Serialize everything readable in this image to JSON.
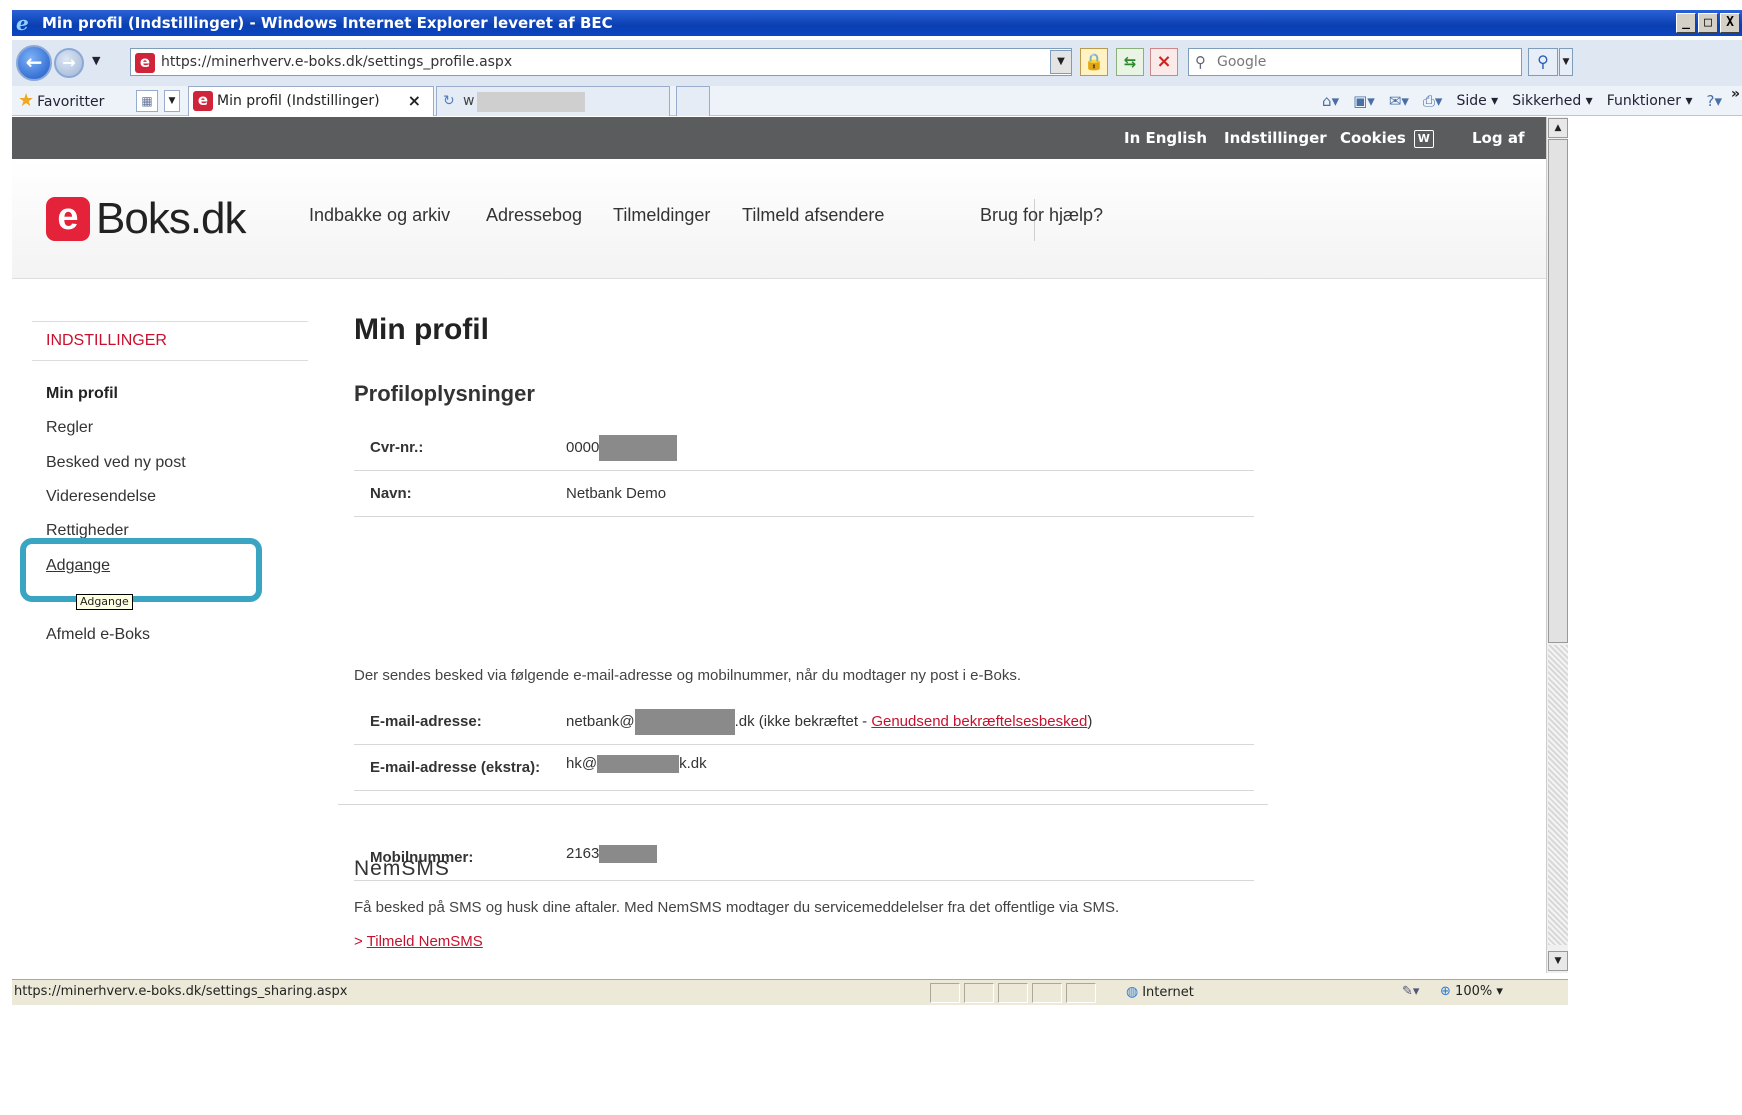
{
  "window": {
    "title": "Min profil (Indstillinger) - Windows Internet Explorer leveret af BEC",
    "controls": [
      "_",
      "□",
      "X"
    ]
  },
  "address_bar": {
    "url": "https://minerhverv.e-boks.dk/settings_profile.aspx",
    "search_placeholder": "Google"
  },
  "favorites_bar": {
    "favorites_label": "Favoritter",
    "active_tab": "Min profil (Indstillinger)",
    "second_tab": "w",
    "commands": [
      "Side ▾",
      "Sikkerhed ▾",
      "Funktioner ▾"
    ]
  },
  "topbar": {
    "english": "In English",
    "settings": "Indstillinger",
    "cookies": "Cookies",
    "logout": "Log af"
  },
  "header": {
    "logo_letter": "e",
    "logo_word": "Boks.dk",
    "nav": [
      "Indbakke og arkiv",
      "Adressebog",
      "Tilmeldinger",
      "Tilmeld afsendere"
    ],
    "help": "Brug for hjælp?"
  },
  "sidebar": {
    "heading": "INDSTILLINGER",
    "items": [
      "Min profil",
      "Regler",
      "Besked ved ny post",
      "Videresendelse",
      "Rettigheder",
      "Adgange",
      "Afmeld e-Boks"
    ],
    "tooltip": "Adgange"
  },
  "main": {
    "title": "Min profil",
    "section": "Profiloplysninger",
    "cvr_label": "Cvr-nr.:",
    "cvr_value": "0000",
    "name_label": "Navn:",
    "name_value": "Netbank Demo",
    "notice": "Der sendes besked via følgende e-mail-adresse og mobilnummer, når du modtager ny post i e-Boks.",
    "email_label": "E-mail-adresse:",
    "email_prefix": "netbank@",
    "email_suffix": ".dk  (ikke bekræftet - ",
    "email_resend": "Genudsend bekræftelsesbesked",
    "email_close": ")",
    "email_extra_label": "E-mail-adresse (ekstra):",
    "email_extra_prefix": "hk@",
    "email_extra_suffix": "k.dk",
    "mobile_label": "Mobilnummer:",
    "mobile_value": "2163"
  },
  "nemsms": {
    "heading": "NemSMS",
    "text": "Få besked på SMS og husk dine aftaler. Med NemSMS modtager du servicemeddelelser fra det offentlige via SMS.",
    "link_prefix": "> ",
    "link": "Tilmeld NemSMS"
  },
  "statusbar": {
    "url": "https://minerhverv.e-boks.dk/settings_sharing.aspx",
    "zone": "Internet",
    "zoom": "100%"
  }
}
